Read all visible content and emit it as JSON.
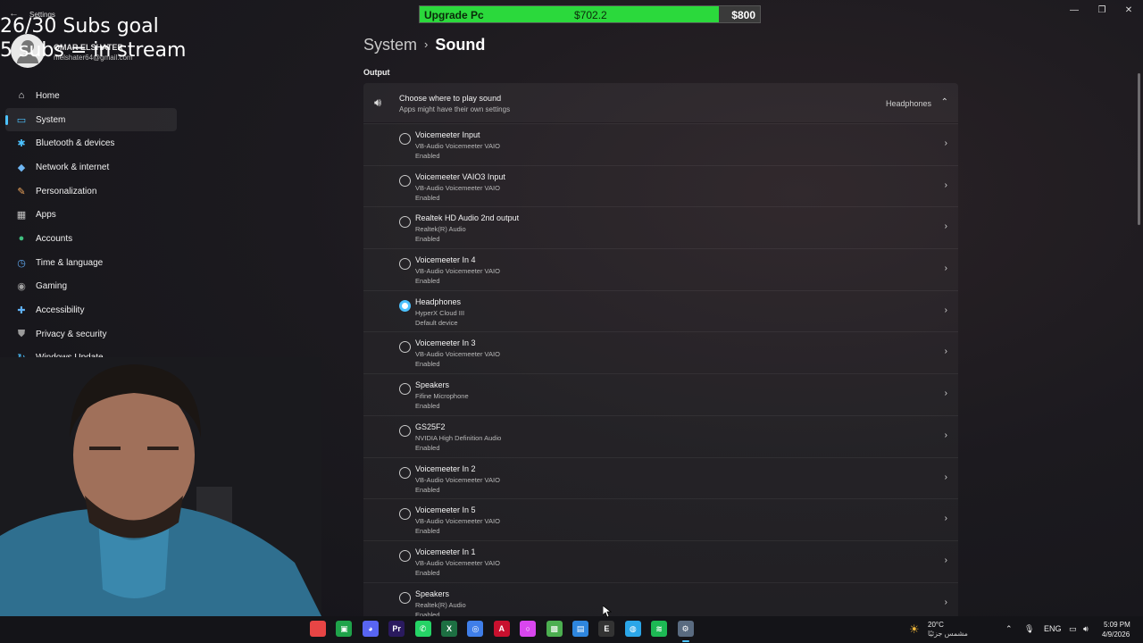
{
  "window": {
    "title": "Settings",
    "back": "←"
  },
  "overlay": {
    "goal_line1": "26/30 Subs goal",
    "goal_line2": "5 subs = in stream",
    "upgrade_label": "Upgrade Pc",
    "upgrade_current": "$702.2",
    "upgrade_target": "$800",
    "upgrade_progress": 0.878,
    "upgrade_color": "#2bd93c"
  },
  "profile": {
    "name": "OMAR ELSHATER",
    "email": "melshater64@gmail.com"
  },
  "sidebar": {
    "items": [
      {
        "label": "Home",
        "icon": "⌂",
        "icon_name": "home-icon",
        "color": "#e8e8e8"
      },
      {
        "label": "System",
        "icon": "▭",
        "icon_name": "system-icon",
        "color": "#4cc2ff",
        "active": true
      },
      {
        "label": "Bluetooth & devices",
        "icon": "✱",
        "icon_name": "bluetooth-icon",
        "color": "#4cc2ff"
      },
      {
        "label": "Network & internet",
        "icon": "◆",
        "icon_name": "network-icon",
        "color": "#6fb6f2"
      },
      {
        "label": "Personalization",
        "icon": "✎",
        "icon_name": "personalization-icon",
        "color": "#f2a85c"
      },
      {
        "label": "Apps",
        "icon": "▦",
        "icon_name": "apps-icon",
        "color": "#c3c3c3"
      },
      {
        "label": "Accounts",
        "icon": "●",
        "icon_name": "accounts-icon",
        "color": "#3fbf7f"
      },
      {
        "label": "Time & language",
        "icon": "◷",
        "icon_name": "time-language-icon",
        "color": "#5fa8f0"
      },
      {
        "label": "Gaming",
        "icon": "◉",
        "icon_name": "gaming-icon",
        "color": "#a0a0a0"
      },
      {
        "label": "Accessibility",
        "icon": "✚",
        "icon_name": "accessibility-icon",
        "color": "#5fb0f5"
      },
      {
        "label": "Privacy & security",
        "icon": "⛊",
        "icon_name": "shield-icon",
        "color": "#9b9b9b"
      },
      {
        "label": "Windows Update",
        "icon": "↻",
        "icon_name": "windows-update-icon",
        "color": "#4cc2ff"
      }
    ]
  },
  "breadcrumb": {
    "parent": "System",
    "separator": "›",
    "current": "Sound"
  },
  "output": {
    "section_label": "Output",
    "header_title": "Choose where to play sound",
    "header_subtitle": "Apps might have their own settings",
    "selected_value": "Headphones",
    "devices": [
      {
        "name": "Voicemeeter Input",
        "driver": "VB-Audio Voicemeeter VAIO",
        "status": "Enabled",
        "selected": false
      },
      {
        "name": "Voicemeeter VAIO3 Input",
        "driver": "VB-Audio Voicemeeter VAIO",
        "status": "Enabled",
        "selected": false
      },
      {
        "name": "Realtek HD Audio 2nd output",
        "driver": "Realtek(R) Audio",
        "status": "Enabled",
        "selected": false
      },
      {
        "name": "Voicemeeter In 4",
        "driver": "VB-Audio Voicemeeter VAIO",
        "status": "Enabled",
        "selected": false
      },
      {
        "name": "Headphones",
        "driver": "HyperX Cloud III",
        "status": "Default device",
        "selected": true
      },
      {
        "name": "Voicemeeter In 3",
        "driver": "VB-Audio Voicemeeter VAIO",
        "status": "Enabled",
        "selected": false
      },
      {
        "name": "Speakers",
        "driver": "Fifine Microphone",
        "status": "Enabled",
        "selected": false
      },
      {
        "name": "GS25F2",
        "driver": "NVIDIA High Definition Audio",
        "status": "Enabled",
        "selected": false
      },
      {
        "name": "Voicemeeter In 2",
        "driver": "VB-Audio Voicemeeter VAIO",
        "status": "Enabled",
        "selected": false
      },
      {
        "name": "Voicemeeter In 5",
        "driver": "VB-Audio Voicemeeter VAIO",
        "status": "Enabled",
        "selected": false
      },
      {
        "name": "Voicemeeter In 1",
        "driver": "VB-Audio Voicemeeter VAIO",
        "status": "Enabled",
        "selected": false
      },
      {
        "name": "Speakers",
        "driver": "Realtek(R) Audio",
        "status": "Enabled",
        "selected": false
      }
    ]
  },
  "taskbar": {
    "apps": [
      {
        "name": "app-icon",
        "color": "#e84545",
        "glyph": ""
      },
      {
        "name": "xbox-app-icon",
        "color": "#1fa34a",
        "glyph": "▣"
      },
      {
        "name": "discord-icon",
        "color": "#5865f2",
        "glyph": "◕"
      },
      {
        "name": "premiere-icon",
        "color": "#2a1a5e",
        "glyph": "Pr"
      },
      {
        "name": "whatsapp-icon",
        "color": "#25d366",
        "glyph": "✆"
      },
      {
        "name": "excel-icon",
        "color": "#1d6f42",
        "glyph": "X"
      },
      {
        "name": "chrome-icon",
        "color": "#3f7ee8",
        "glyph": "◎"
      },
      {
        "name": "adobe-icon",
        "color": "#c8102e",
        "glyph": "A"
      },
      {
        "name": "ring-app-icon",
        "color": "#d946ef",
        "glyph": "○"
      },
      {
        "name": "minecraft-icon",
        "color": "#4caf50",
        "glyph": "▩"
      },
      {
        "name": "notepad-icon",
        "color": "#2e86de",
        "glyph": "▤"
      },
      {
        "name": "epic-games-icon",
        "color": "#333333",
        "glyph": "E"
      },
      {
        "name": "browser-icon",
        "color": "#2ba6e8",
        "glyph": "◍"
      },
      {
        "name": "spotify-icon",
        "color": "#1db954",
        "glyph": "≋"
      },
      {
        "name": "settings-icon",
        "color": "#5a6b80",
        "glyph": "⚙"
      }
    ],
    "weather_temp": "20°C",
    "weather_desc": "مشمس جزئيًا",
    "language": "ENG",
    "time": "5:09 PM",
    "date": "4/9/2026"
  }
}
